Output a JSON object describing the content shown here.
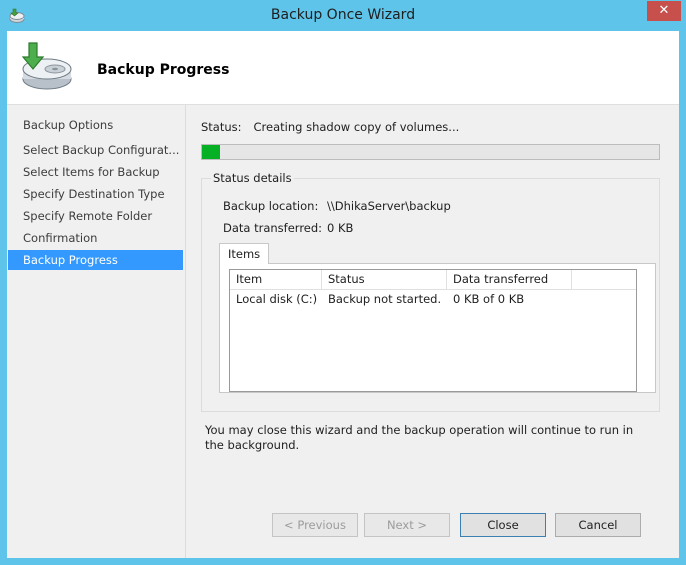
{
  "window": {
    "title": "Backup Once Wizard",
    "close_glyph": "✕"
  },
  "header": {
    "title": "Backup Progress",
    "icon": "backup-disk-icon"
  },
  "nav": {
    "items": [
      {
        "label": "Backup Options"
      },
      {
        "label": "Select Backup Configurat..."
      },
      {
        "label": "Select Items for Backup"
      },
      {
        "label": "Specify Destination Type"
      },
      {
        "label": "Specify Remote Folder"
      },
      {
        "label": "Confirmation"
      },
      {
        "label": "Backup Progress"
      }
    ],
    "active_index": 6
  },
  "status": {
    "label": "Status:",
    "value": "Creating shadow copy of volumes..."
  },
  "progress": {
    "percent": 4,
    "color": "#06b025"
  },
  "status_details": {
    "title": "Status details",
    "backup_location_label": "Backup location:",
    "backup_location_value": "\\\\DhikaServer\\backup",
    "data_transferred_label": "Data transferred:",
    "data_transferred_value": "0 KB",
    "tab_label": "Items",
    "columns": [
      "Item",
      "Status",
      "Data transferred"
    ],
    "rows": [
      {
        "item": "Local disk (C:)",
        "status": "Backup not started.",
        "transferred": "0 KB of 0 KB"
      }
    ]
  },
  "note": "You may close this wizard and the backup operation will continue to run in the background.",
  "buttons": {
    "previous": "< Previous",
    "next": "Next >",
    "close": "Close",
    "cancel": "Cancel"
  },
  "colors": {
    "title_bar": "#5fc4ea",
    "selection": "#3399ff",
    "close_button": "#c7504c"
  }
}
